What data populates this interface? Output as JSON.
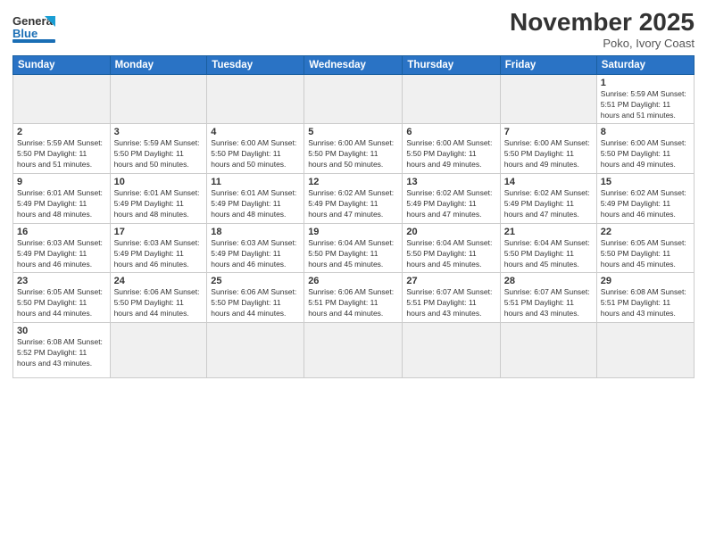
{
  "header": {
    "logo_general": "General",
    "logo_blue": "Blue",
    "title": "November 2025",
    "subtitle": "Poko, Ivory Coast"
  },
  "days_of_week": [
    "Sunday",
    "Monday",
    "Tuesday",
    "Wednesday",
    "Thursday",
    "Friday",
    "Saturday"
  ],
  "weeks": [
    [
      {
        "day": "",
        "info": ""
      },
      {
        "day": "",
        "info": ""
      },
      {
        "day": "",
        "info": ""
      },
      {
        "day": "",
        "info": ""
      },
      {
        "day": "",
        "info": ""
      },
      {
        "day": "",
        "info": ""
      },
      {
        "day": "1",
        "info": "Sunrise: 5:59 AM\nSunset: 5:51 PM\nDaylight: 11 hours\nand 51 minutes."
      }
    ],
    [
      {
        "day": "2",
        "info": "Sunrise: 5:59 AM\nSunset: 5:50 PM\nDaylight: 11 hours\nand 51 minutes."
      },
      {
        "day": "3",
        "info": "Sunrise: 5:59 AM\nSunset: 5:50 PM\nDaylight: 11 hours\nand 50 minutes."
      },
      {
        "day": "4",
        "info": "Sunrise: 6:00 AM\nSunset: 5:50 PM\nDaylight: 11 hours\nand 50 minutes."
      },
      {
        "day": "5",
        "info": "Sunrise: 6:00 AM\nSunset: 5:50 PM\nDaylight: 11 hours\nand 50 minutes."
      },
      {
        "day": "6",
        "info": "Sunrise: 6:00 AM\nSunset: 5:50 PM\nDaylight: 11 hours\nand 49 minutes."
      },
      {
        "day": "7",
        "info": "Sunrise: 6:00 AM\nSunset: 5:50 PM\nDaylight: 11 hours\nand 49 minutes."
      },
      {
        "day": "8",
        "info": "Sunrise: 6:00 AM\nSunset: 5:50 PM\nDaylight: 11 hours\nand 49 minutes."
      }
    ],
    [
      {
        "day": "9",
        "info": "Sunrise: 6:01 AM\nSunset: 5:49 PM\nDaylight: 11 hours\nand 48 minutes."
      },
      {
        "day": "10",
        "info": "Sunrise: 6:01 AM\nSunset: 5:49 PM\nDaylight: 11 hours\nand 48 minutes."
      },
      {
        "day": "11",
        "info": "Sunrise: 6:01 AM\nSunset: 5:49 PM\nDaylight: 11 hours\nand 48 minutes."
      },
      {
        "day": "12",
        "info": "Sunrise: 6:02 AM\nSunset: 5:49 PM\nDaylight: 11 hours\nand 47 minutes."
      },
      {
        "day": "13",
        "info": "Sunrise: 6:02 AM\nSunset: 5:49 PM\nDaylight: 11 hours\nand 47 minutes."
      },
      {
        "day": "14",
        "info": "Sunrise: 6:02 AM\nSunset: 5:49 PM\nDaylight: 11 hours\nand 47 minutes."
      },
      {
        "day": "15",
        "info": "Sunrise: 6:02 AM\nSunset: 5:49 PM\nDaylight: 11 hours\nand 46 minutes."
      }
    ],
    [
      {
        "day": "16",
        "info": "Sunrise: 6:03 AM\nSunset: 5:49 PM\nDaylight: 11 hours\nand 46 minutes."
      },
      {
        "day": "17",
        "info": "Sunrise: 6:03 AM\nSunset: 5:49 PM\nDaylight: 11 hours\nand 46 minutes."
      },
      {
        "day": "18",
        "info": "Sunrise: 6:03 AM\nSunset: 5:49 PM\nDaylight: 11 hours\nand 46 minutes."
      },
      {
        "day": "19",
        "info": "Sunrise: 6:04 AM\nSunset: 5:50 PM\nDaylight: 11 hours\nand 45 minutes."
      },
      {
        "day": "20",
        "info": "Sunrise: 6:04 AM\nSunset: 5:50 PM\nDaylight: 11 hours\nand 45 minutes."
      },
      {
        "day": "21",
        "info": "Sunrise: 6:04 AM\nSunset: 5:50 PM\nDaylight: 11 hours\nand 45 minutes."
      },
      {
        "day": "22",
        "info": "Sunrise: 6:05 AM\nSunset: 5:50 PM\nDaylight: 11 hours\nand 45 minutes."
      }
    ],
    [
      {
        "day": "23",
        "info": "Sunrise: 6:05 AM\nSunset: 5:50 PM\nDaylight: 11 hours\nand 44 minutes."
      },
      {
        "day": "24",
        "info": "Sunrise: 6:06 AM\nSunset: 5:50 PM\nDaylight: 11 hours\nand 44 minutes."
      },
      {
        "day": "25",
        "info": "Sunrise: 6:06 AM\nSunset: 5:50 PM\nDaylight: 11 hours\nand 44 minutes."
      },
      {
        "day": "26",
        "info": "Sunrise: 6:06 AM\nSunset: 5:51 PM\nDaylight: 11 hours\nand 44 minutes."
      },
      {
        "day": "27",
        "info": "Sunrise: 6:07 AM\nSunset: 5:51 PM\nDaylight: 11 hours\nand 43 minutes."
      },
      {
        "day": "28",
        "info": "Sunrise: 6:07 AM\nSunset: 5:51 PM\nDaylight: 11 hours\nand 43 minutes."
      },
      {
        "day": "29",
        "info": "Sunrise: 6:08 AM\nSunset: 5:51 PM\nDaylight: 11 hours\nand 43 minutes."
      }
    ],
    [
      {
        "day": "30",
        "info": "Sunrise: 6:08 AM\nSunset: 5:52 PM\nDaylight: 11 hours\nand 43 minutes."
      },
      {
        "day": "",
        "info": ""
      },
      {
        "day": "",
        "info": ""
      },
      {
        "day": "",
        "info": ""
      },
      {
        "day": "",
        "info": ""
      },
      {
        "day": "",
        "info": ""
      },
      {
        "day": "",
        "info": ""
      }
    ]
  ]
}
